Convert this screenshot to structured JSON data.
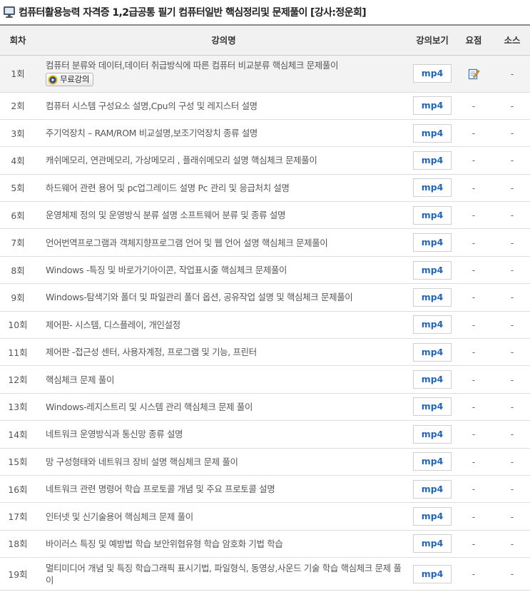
{
  "page": {
    "title": "컴퓨터활용능력 자격증 1,2급공통 필기 컴퓨터일반 핵심정리및 문제풀이 [강사:정운회]",
    "title_icon": "monitor-icon"
  },
  "table": {
    "headers": {
      "no": "회차",
      "title": "강의명",
      "view": "강의보기",
      "summary": "요점",
      "source": "소스"
    },
    "free_label": "무료강의",
    "rows": [
      {
        "no": "1회",
        "title": "컴퓨터 분류와 데이터,데이터 취급방식에 따른 컴퓨터 비교분류  핵심체크 문제풀이",
        "view": "mp4",
        "summary": "",
        "source": "-"
      },
      {
        "no": "2회",
        "title": "컴퓨터 시스템 구성요소 설명,Cpu의 구성 및 레지스터 설명",
        "view": "mp4",
        "summary": "-",
        "source": "-"
      },
      {
        "no": "3회",
        "title": "주기억장치 – RAM/ROM 비교설명,보조기억장치 종류 설명",
        "view": "mp4",
        "summary": "-",
        "source": "-"
      },
      {
        "no": "4회",
        "title": "캐쉬메모리, 연관메모리, 가상메모리 , 플래쉬메모리 설명  핵심체크 문제풀이",
        "view": "mp4",
        "summary": "-",
        "source": "-"
      },
      {
        "no": "5회",
        "title": "하드웨어 관련 용어 및 pc업그레이드 설명  Pc 관리 및 응급처치 설명",
        "view": "mp4",
        "summary": "-",
        "source": "-"
      },
      {
        "no": "6회",
        "title": "운영체제 정의 및 운영방식 분류 설명  소프트웨어 분류 및 종류 설명",
        "view": "mp4",
        "summary": "-",
        "source": "-"
      },
      {
        "no": "7회",
        "title": "언어번역프로그램과 객체지향프로그램 언어 및 웹 언어 설명  핵심체크 문제풀이",
        "view": "mp4",
        "summary": "-",
        "source": "-"
      },
      {
        "no": "8회",
        "title": "Windows -특징 및 바로가기아이콘, 작업표시줄  핵심체크 문제풀이",
        "view": "mp4",
        "summary": "-",
        "source": "-"
      },
      {
        "no": "9회",
        "title": "Windows-탐색기와 폴더 및 파일관리 폴더 옵션, 공유작업 설명 및 핵심체크 문제풀이",
        "view": "mp4",
        "summary": "-",
        "source": "-"
      },
      {
        "no": "10회",
        "title": "제어판- 시스템, 디스플레이, 개인설정",
        "view": "mp4",
        "summary": "-",
        "source": "-"
      },
      {
        "no": "11회",
        "title": "제어판 -접근성 센터, 사용자계정, 프로그램 및 기능, 프린터",
        "view": "mp4",
        "summary": "-",
        "source": "-"
      },
      {
        "no": "12회",
        "title": "핵심체크 문제 풀이",
        "view": "mp4",
        "summary": "-",
        "source": "-"
      },
      {
        "no": "13회",
        "title": "Windows-레지스트리 및 시스템 관리  핵심체크 문제 풀이",
        "view": "mp4",
        "summary": "-",
        "source": "-"
      },
      {
        "no": "14회",
        "title": "네트워크 운영방식과 통신망 종류 설명",
        "view": "mp4",
        "summary": "-",
        "source": "-"
      },
      {
        "no": "15회",
        "title": "망 구성형태와 네트워크 장비 설명  핵심체크 문제 풀이",
        "view": "mp4",
        "summary": "-",
        "source": "-"
      },
      {
        "no": "16회",
        "title": "네트워크 관련 명령어 학습  프로토콜 개념 및 주요 프로토콜 설명",
        "view": "mp4",
        "summary": "-",
        "source": "-"
      },
      {
        "no": "17회",
        "title": "인터넷 및 신기술용어  핵심체크 문제 풀이",
        "view": "mp4",
        "summary": "-",
        "source": "-"
      },
      {
        "no": "18회",
        "title": "바이러스 특징 및 예방법 학습  보안위협유형 학습  암호화 기법 학습",
        "view": "mp4",
        "summary": "-",
        "source": "-"
      },
      {
        "no": "19회",
        "title": "멀티미디어 개념 및 특징 학습그래픽 표시기법, 파일형식, 동영상,사운드 기술 학습  핵심체크 문제 풀이",
        "view": "mp4",
        "summary": "-",
        "source": "-"
      }
    ]
  },
  "colors": {
    "mp4_text": "#2266bb",
    "header_bg": "#f1f1f1",
    "first_row_bg": "#f3f3f3"
  }
}
